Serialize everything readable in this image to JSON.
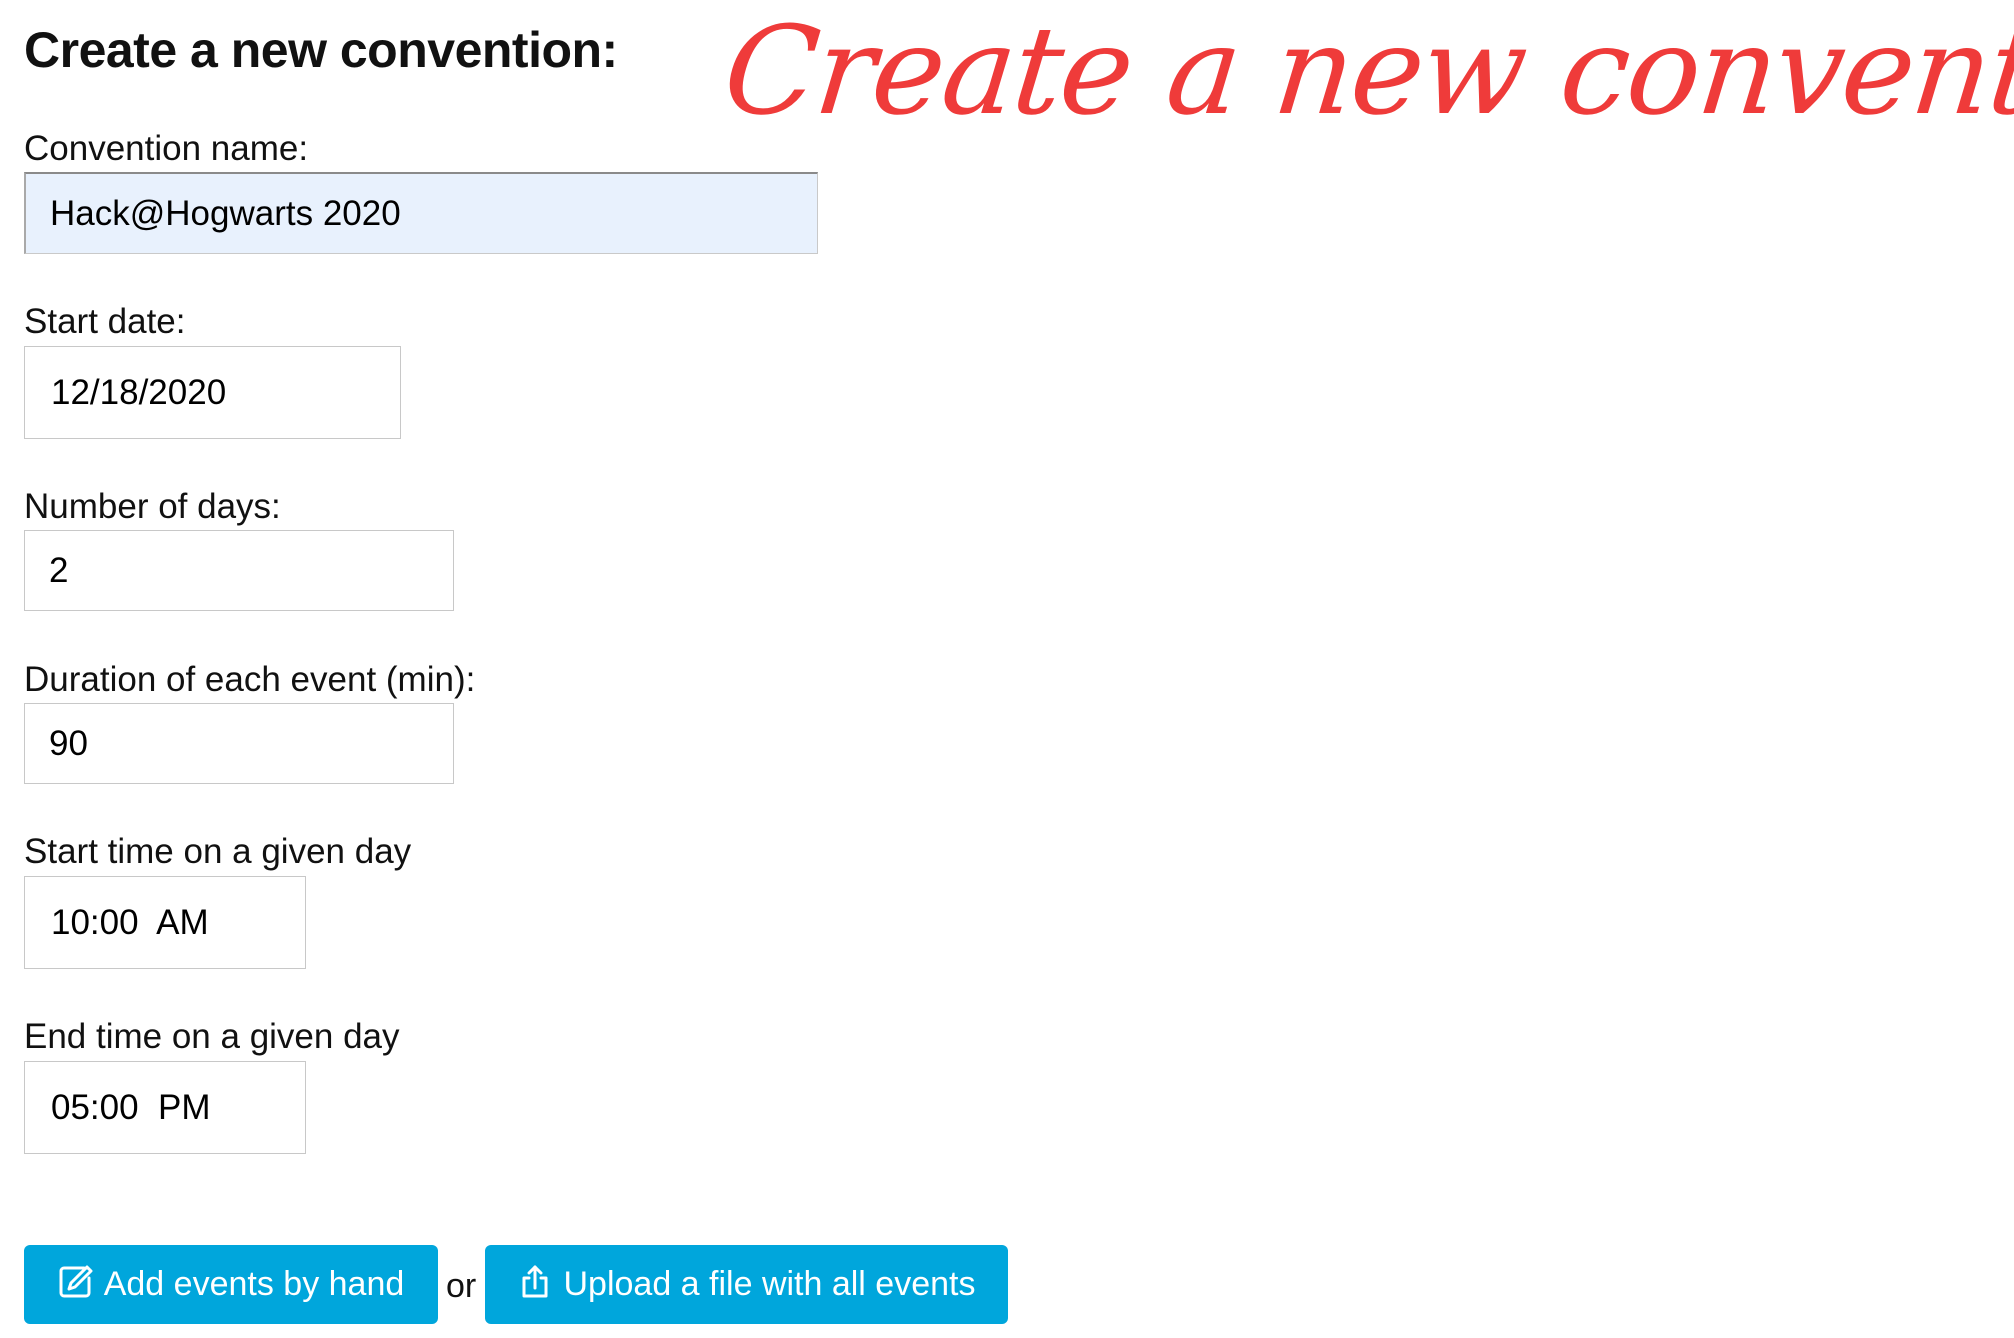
{
  "header": {
    "title": "Create a new convention:",
    "banner": "Create a new convention..."
  },
  "form": {
    "convention_name": {
      "label": "Convention name:",
      "value": "Hack@Hogwarts 2020"
    },
    "start_date": {
      "label": "Start date:",
      "value": "12/18/2020"
    },
    "number_of_days": {
      "label": "Number of days:",
      "value": "2"
    },
    "event_duration": {
      "label": "Duration of each event (min):",
      "value": "90"
    },
    "start_time": {
      "label": "Start time on a given day",
      "value": "10:00  AM"
    },
    "end_time": {
      "label": "End time on a given day",
      "value": "05:00  PM"
    }
  },
  "actions": {
    "add_by_hand": {
      "label": "Add events by hand",
      "icon": "edit-icon"
    },
    "separator": "or",
    "upload_file": {
      "label": "Upload a file with all events",
      "icon": "upload-icon"
    }
  },
  "colors": {
    "accent": "#00a6dc",
    "banner": "#ef3b3a",
    "autofill_background": "#e8f1fd"
  }
}
